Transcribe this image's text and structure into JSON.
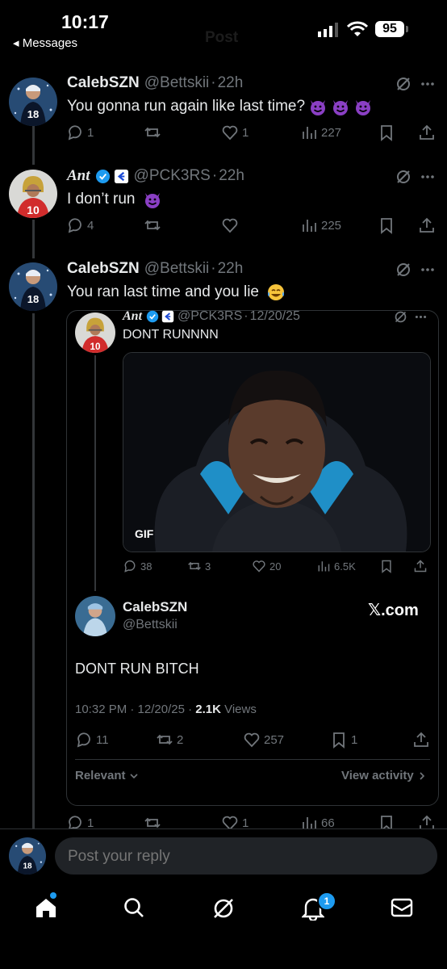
{
  "status_bar": {
    "time": "10:17",
    "back_label": "◂ Messages",
    "battery": "95",
    "faded_title": "Post"
  },
  "tweets": [
    {
      "name": "CalebSZN",
      "handle": "@Bettskii",
      "sep": "·",
      "time": "22h",
      "text": "You gonna run again like last time?",
      "emoji": "smiling-devil x3",
      "replies": "1",
      "retweets": "",
      "likes": "1",
      "views": "227"
    },
    {
      "name": "Ant",
      "handle": "@PCK3RS",
      "sep": "·",
      "time": "22h",
      "text": "I don’t run",
      "emoji": "smiling-devil",
      "replies": "4",
      "retweets": "",
      "likes": "",
      "views": "225"
    },
    {
      "name": "CalebSZN",
      "handle": "@Bettskii",
      "sep": "·",
      "time": "22h",
      "text": "You ran last time and you lie",
      "emoji": "tears-of-joy",
      "replies": "1",
      "retweets": "",
      "likes": "1",
      "views": "66"
    }
  ],
  "quoted_post": {
    "name": "Ant",
    "handle": "@PCK3RS",
    "sep": "·",
    "date": "12/20/25",
    "text": "DONT RUNNNN",
    "gif_label": "GIF",
    "replies": "38",
    "retweets": "3",
    "likes": "20",
    "views": "6.5K"
  },
  "embedded_card": {
    "name": "CalebSZN",
    "handle": "@Bettskii",
    "site": "𝕏.com",
    "text": "DONT RUN BITCH",
    "timestamp": "10:32 PM · 12/20/25 · ",
    "views_count": "2.1K",
    "views_label": " Views",
    "replies": "11",
    "retweets": "2",
    "likes": "257",
    "bookmarks": "1",
    "relevant_label": "Relevant",
    "view_activity_label": "View activity"
  },
  "reply_box": {
    "placeholder": "Post your reply"
  },
  "bottom_nav": {
    "notification_count": "1"
  },
  "colors": {
    "background": "#000000",
    "text": "#e7e9ea",
    "muted": "#71767b",
    "verified": "#1d9bf0",
    "nav_dot": "#1d9bf0"
  }
}
